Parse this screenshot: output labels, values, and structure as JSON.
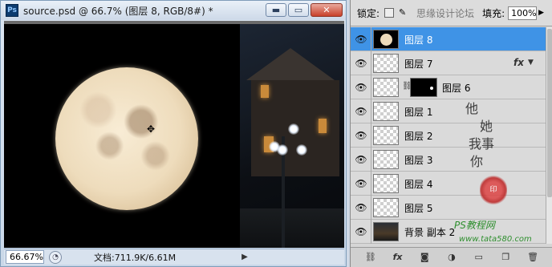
{
  "document": {
    "title": "source.psd @ 66.7% (图层 8, RGB/8#) *",
    "app_icon": "Ps",
    "window_buttons": {
      "minimize": "▬",
      "restore": "▭",
      "close": "✕"
    },
    "zoom": "66.67%",
    "doc_size": "文档:711.9K/6.61M",
    "status_arrow": "▶"
  },
  "layers_panel": {
    "lock_label": "锁定:",
    "lock_overlay_text": "思缘设计论坛",
    "fill_label": "填充:",
    "fill_value": "100%",
    "layers": [
      {
        "name": "图层 8",
        "visible": true,
        "selected": true,
        "thumb": "moon"
      },
      {
        "name": "图层 7",
        "visible": true,
        "selected": false,
        "thumb": "transparent",
        "fx": "fx"
      },
      {
        "name": "图层 6",
        "visible": true,
        "selected": false,
        "thumb": "transparent",
        "has_mask": true
      },
      {
        "name": "图层 1",
        "visible": true,
        "selected": false,
        "thumb": "transparent"
      },
      {
        "name": "图层 2",
        "visible": true,
        "selected": false,
        "thumb": "transparent"
      },
      {
        "name": "图层 3",
        "visible": true,
        "selected": false,
        "thumb": "transparent"
      },
      {
        "name": "图层 4",
        "visible": true,
        "selected": false,
        "thumb": "transparent"
      },
      {
        "name": "图层 5",
        "visible": true,
        "selected": false,
        "thumb": "transparent"
      },
      {
        "name": "背景 副本 2",
        "visible": true,
        "selected": false,
        "thumb": "background"
      }
    ],
    "toolbar_icons": [
      "link-layers-icon",
      "fx-icon",
      "mask-icon",
      "adjustment-icon",
      "group-icon",
      "new-layer-icon",
      "trash-icon"
    ]
  },
  "watermark": {
    "calligraphy": [
      "他",
      "她",
      "我",
      "事",
      "你"
    ],
    "seal": "印",
    "ps_text": "PS教程网",
    "url": "www.tata580.com"
  },
  "colors": {
    "selected_layer": "#3f93e6",
    "panel_bg": "#d6d6d6"
  }
}
